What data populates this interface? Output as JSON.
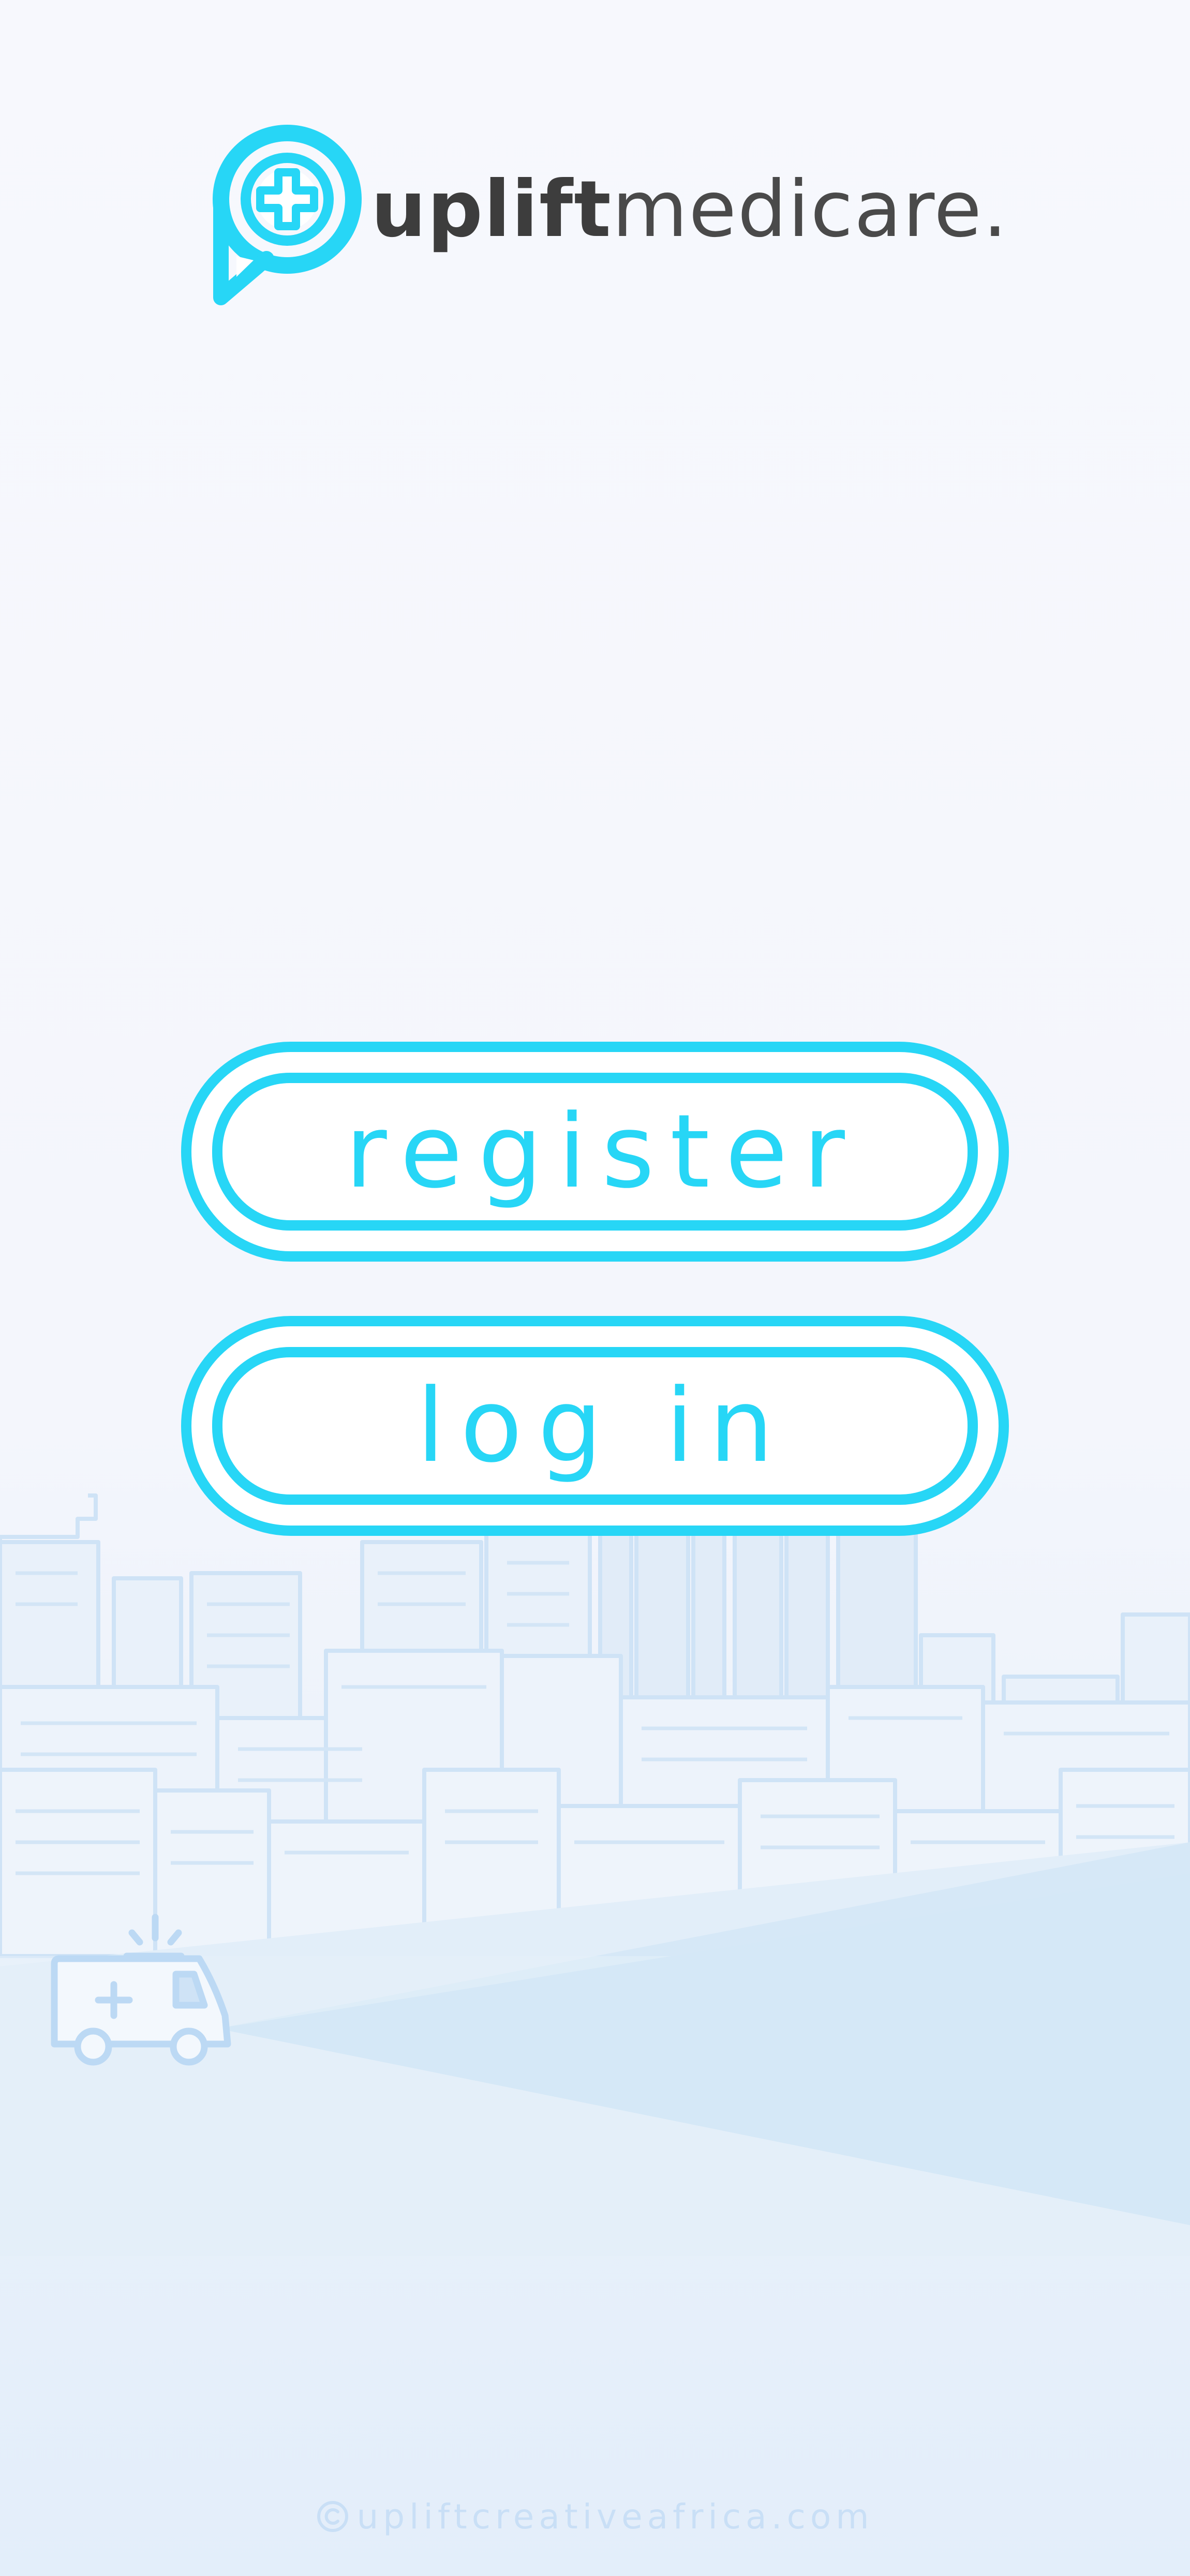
{
  "app": {
    "brand_bold": "uplift",
    "brand_light": "medicare.",
    "logo_icon": "speech-bubble-medical-cross-icon"
  },
  "actions": {
    "register_label": "register",
    "login_label": "log in"
  },
  "footer": {
    "copyright_icon": "copyright-icon",
    "credit": "upliftcreativeafrica.com"
  },
  "illustration": {
    "scene": "city-skyline-illustration",
    "vehicle_icon": "ambulance-icon"
  },
  "colors": {
    "accent": "#27d6f6",
    "brand_text": "#454545",
    "skyline_line": "#c8e0f6",
    "skyline_fill": "#e4eef9",
    "ground": "#d5e8f7",
    "footer_text": "#c9dff6",
    "background": "#f6f7fc"
  }
}
